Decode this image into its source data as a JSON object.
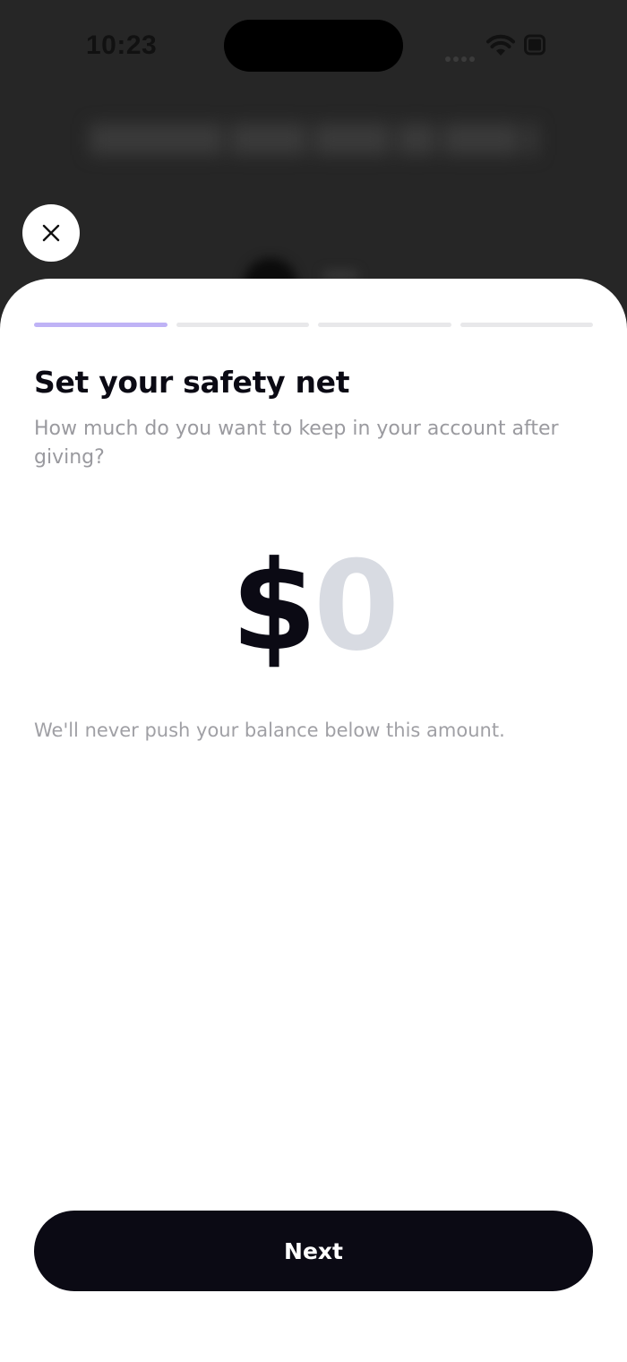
{
  "status_bar": {
    "time": "10:23",
    "icons": [
      "cellular-dots-icon",
      "wifi-icon",
      "battery-icon"
    ]
  },
  "sheet": {
    "progress": {
      "total_steps": 4,
      "current_step": 1
    },
    "title": "Set your safety net",
    "subtitle": "How much do you want to keep in your account after giving?",
    "amount": {
      "currency": "$",
      "value": "0"
    },
    "hint": "We'll never push your balance below this amount.",
    "next_label": "Next"
  },
  "colors": {
    "accent": "#bfb3f6",
    "primary_dark": "#0b0a14",
    "muted_text": "#9a9a9f",
    "placeholder_amount": "#d8dbe2",
    "backdrop": "#262626"
  }
}
